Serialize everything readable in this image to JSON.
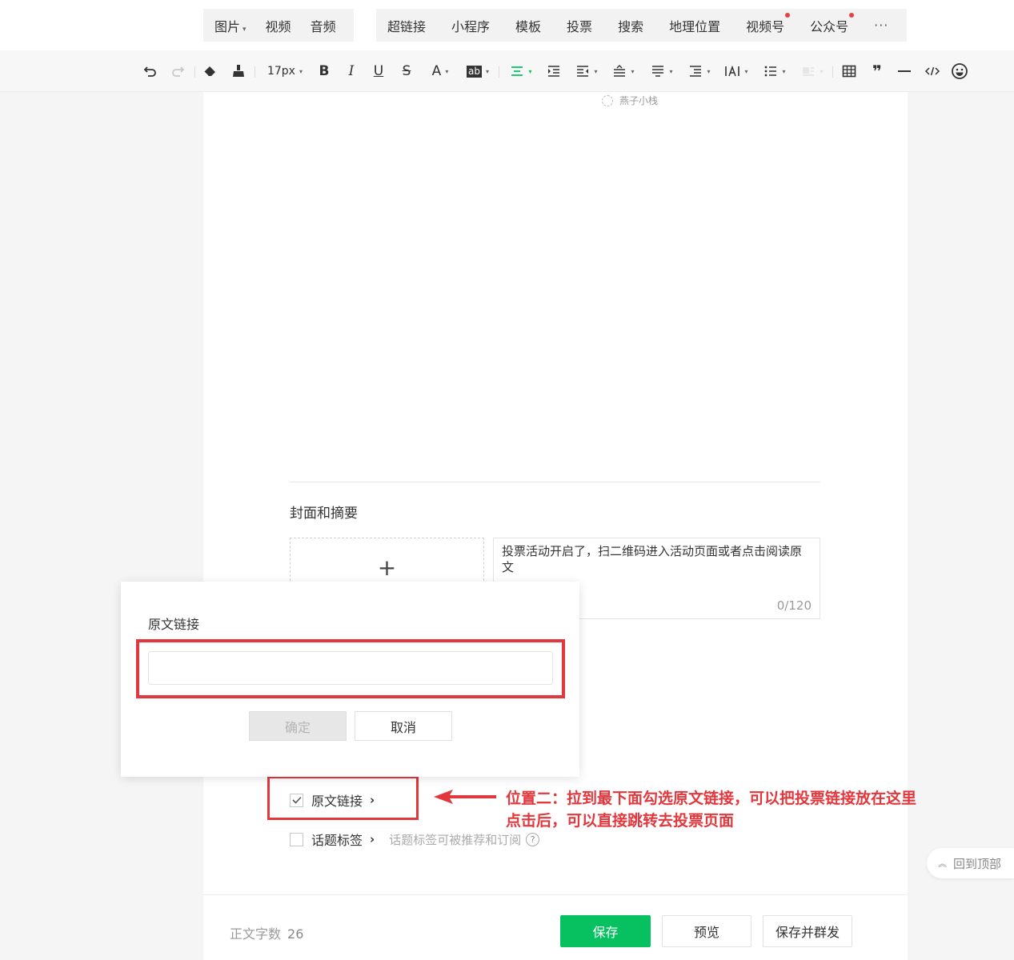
{
  "insert_toolbar": {
    "group1": [
      {
        "label": "图片",
        "dropdown": true
      },
      {
        "label": "视频"
      },
      {
        "label": "音频"
      }
    ],
    "group2": [
      {
        "label": "超链接"
      },
      {
        "label": "小程序"
      },
      {
        "label": "模板"
      },
      {
        "label": "投票"
      },
      {
        "label": "搜索"
      },
      {
        "label": "地理位置"
      },
      {
        "label": "视频号",
        "badge": true
      },
      {
        "label": "公众号",
        "badge": true
      }
    ],
    "more": "···"
  },
  "format_toolbar": {
    "font_size": "17px",
    "bold": "B",
    "italic": "I",
    "underline": "U",
    "strike": "S",
    "font_color": "A",
    "highlight": "ab"
  },
  "editor": {
    "watermark": "燕子小栈",
    "cover_title": "封面和摘要",
    "cover_add": "+",
    "summary_text": "投票活动开启了，扫二维码进入活动页面或者点击阅读原文",
    "summary_count": "0/120",
    "options": {
      "original_link": {
        "label": "原文链接",
        "checked": true
      },
      "topic_tags": {
        "label": "话题标签",
        "checked": false,
        "hint": "话题标签可被推荐和订阅",
        "help": "?"
      }
    }
  },
  "annotation": {
    "line1": "位置二：拉到最下面勾选原文链接，可以把投票链接放在这里",
    "line2": "点击后，可以直接跳转去投票页面"
  },
  "footer": {
    "wordcount_label": "正文字数",
    "wordcount_value": "26",
    "save": "保存",
    "preview": "预览",
    "save_mass": "保存并群发"
  },
  "back_top": "回到顶部",
  "dialog": {
    "title": "原文链接",
    "input_value": "",
    "input_placeholder": "",
    "ok": "确定",
    "cancel": "取消"
  },
  "colors": {
    "accent_green": "#07c160",
    "highlight_red": "#e2373c",
    "badge_red": "#e64340"
  }
}
